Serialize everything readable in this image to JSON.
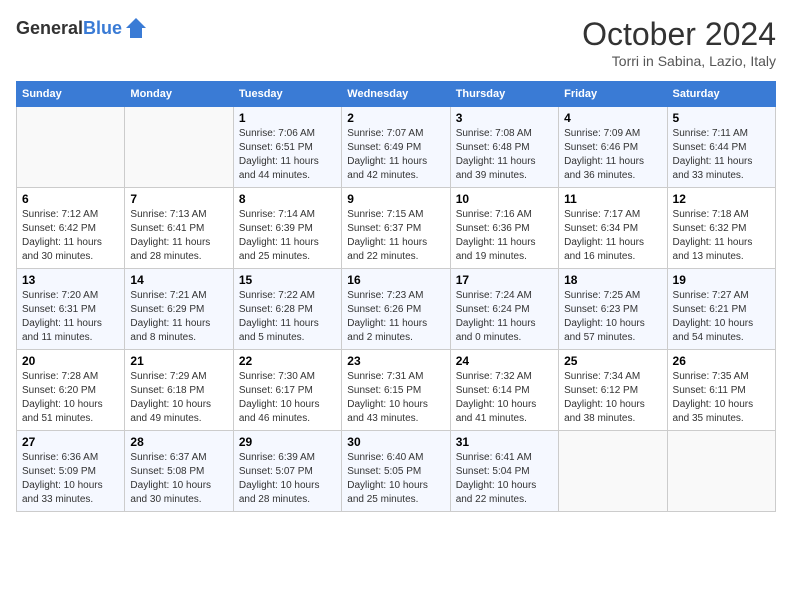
{
  "header": {
    "logo_general": "General",
    "logo_blue": "Blue",
    "title": "October 2024",
    "location": "Torri in Sabina, Lazio, Italy"
  },
  "days_of_week": [
    "Sunday",
    "Monday",
    "Tuesday",
    "Wednesday",
    "Thursday",
    "Friday",
    "Saturday"
  ],
  "weeks": [
    [
      {
        "day": "",
        "sunrise": "",
        "sunset": "",
        "daylight": ""
      },
      {
        "day": "",
        "sunrise": "",
        "sunset": "",
        "daylight": ""
      },
      {
        "day": "1",
        "sunrise": "Sunrise: 7:06 AM",
        "sunset": "Sunset: 6:51 PM",
        "daylight": "Daylight: 11 hours and 44 minutes."
      },
      {
        "day": "2",
        "sunrise": "Sunrise: 7:07 AM",
        "sunset": "Sunset: 6:49 PM",
        "daylight": "Daylight: 11 hours and 42 minutes."
      },
      {
        "day": "3",
        "sunrise": "Sunrise: 7:08 AM",
        "sunset": "Sunset: 6:48 PM",
        "daylight": "Daylight: 11 hours and 39 minutes."
      },
      {
        "day": "4",
        "sunrise": "Sunrise: 7:09 AM",
        "sunset": "Sunset: 6:46 PM",
        "daylight": "Daylight: 11 hours and 36 minutes."
      },
      {
        "day": "5",
        "sunrise": "Sunrise: 7:11 AM",
        "sunset": "Sunset: 6:44 PM",
        "daylight": "Daylight: 11 hours and 33 minutes."
      }
    ],
    [
      {
        "day": "6",
        "sunrise": "Sunrise: 7:12 AM",
        "sunset": "Sunset: 6:42 PM",
        "daylight": "Daylight: 11 hours and 30 minutes."
      },
      {
        "day": "7",
        "sunrise": "Sunrise: 7:13 AM",
        "sunset": "Sunset: 6:41 PM",
        "daylight": "Daylight: 11 hours and 28 minutes."
      },
      {
        "day": "8",
        "sunrise": "Sunrise: 7:14 AM",
        "sunset": "Sunset: 6:39 PM",
        "daylight": "Daylight: 11 hours and 25 minutes."
      },
      {
        "day": "9",
        "sunrise": "Sunrise: 7:15 AM",
        "sunset": "Sunset: 6:37 PM",
        "daylight": "Daylight: 11 hours and 22 minutes."
      },
      {
        "day": "10",
        "sunrise": "Sunrise: 7:16 AM",
        "sunset": "Sunset: 6:36 PM",
        "daylight": "Daylight: 11 hours and 19 minutes."
      },
      {
        "day": "11",
        "sunrise": "Sunrise: 7:17 AM",
        "sunset": "Sunset: 6:34 PM",
        "daylight": "Daylight: 11 hours and 16 minutes."
      },
      {
        "day": "12",
        "sunrise": "Sunrise: 7:18 AM",
        "sunset": "Sunset: 6:32 PM",
        "daylight": "Daylight: 11 hours and 13 minutes."
      }
    ],
    [
      {
        "day": "13",
        "sunrise": "Sunrise: 7:20 AM",
        "sunset": "Sunset: 6:31 PM",
        "daylight": "Daylight: 11 hours and 11 minutes."
      },
      {
        "day": "14",
        "sunrise": "Sunrise: 7:21 AM",
        "sunset": "Sunset: 6:29 PM",
        "daylight": "Daylight: 11 hours and 8 minutes."
      },
      {
        "day": "15",
        "sunrise": "Sunrise: 7:22 AM",
        "sunset": "Sunset: 6:28 PM",
        "daylight": "Daylight: 11 hours and 5 minutes."
      },
      {
        "day": "16",
        "sunrise": "Sunrise: 7:23 AM",
        "sunset": "Sunset: 6:26 PM",
        "daylight": "Daylight: 11 hours and 2 minutes."
      },
      {
        "day": "17",
        "sunrise": "Sunrise: 7:24 AM",
        "sunset": "Sunset: 6:24 PM",
        "daylight": "Daylight: 11 hours and 0 minutes."
      },
      {
        "day": "18",
        "sunrise": "Sunrise: 7:25 AM",
        "sunset": "Sunset: 6:23 PM",
        "daylight": "Daylight: 10 hours and 57 minutes."
      },
      {
        "day": "19",
        "sunrise": "Sunrise: 7:27 AM",
        "sunset": "Sunset: 6:21 PM",
        "daylight": "Daylight: 10 hours and 54 minutes."
      }
    ],
    [
      {
        "day": "20",
        "sunrise": "Sunrise: 7:28 AM",
        "sunset": "Sunset: 6:20 PM",
        "daylight": "Daylight: 10 hours and 51 minutes."
      },
      {
        "day": "21",
        "sunrise": "Sunrise: 7:29 AM",
        "sunset": "Sunset: 6:18 PM",
        "daylight": "Daylight: 10 hours and 49 minutes."
      },
      {
        "day": "22",
        "sunrise": "Sunrise: 7:30 AM",
        "sunset": "Sunset: 6:17 PM",
        "daylight": "Daylight: 10 hours and 46 minutes."
      },
      {
        "day": "23",
        "sunrise": "Sunrise: 7:31 AM",
        "sunset": "Sunset: 6:15 PM",
        "daylight": "Daylight: 10 hours and 43 minutes."
      },
      {
        "day": "24",
        "sunrise": "Sunrise: 7:32 AM",
        "sunset": "Sunset: 6:14 PM",
        "daylight": "Daylight: 10 hours and 41 minutes."
      },
      {
        "day": "25",
        "sunrise": "Sunrise: 7:34 AM",
        "sunset": "Sunset: 6:12 PM",
        "daylight": "Daylight: 10 hours and 38 minutes."
      },
      {
        "day": "26",
        "sunrise": "Sunrise: 7:35 AM",
        "sunset": "Sunset: 6:11 PM",
        "daylight": "Daylight: 10 hours and 35 minutes."
      }
    ],
    [
      {
        "day": "27",
        "sunrise": "Sunrise: 6:36 AM",
        "sunset": "Sunset: 5:09 PM",
        "daylight": "Daylight: 10 hours and 33 minutes."
      },
      {
        "day": "28",
        "sunrise": "Sunrise: 6:37 AM",
        "sunset": "Sunset: 5:08 PM",
        "daylight": "Daylight: 10 hours and 30 minutes."
      },
      {
        "day": "29",
        "sunrise": "Sunrise: 6:39 AM",
        "sunset": "Sunset: 5:07 PM",
        "daylight": "Daylight: 10 hours and 28 minutes."
      },
      {
        "day": "30",
        "sunrise": "Sunrise: 6:40 AM",
        "sunset": "Sunset: 5:05 PM",
        "daylight": "Daylight: 10 hours and 25 minutes."
      },
      {
        "day": "31",
        "sunrise": "Sunrise: 6:41 AM",
        "sunset": "Sunset: 5:04 PM",
        "daylight": "Daylight: 10 hours and 22 minutes."
      },
      {
        "day": "",
        "sunrise": "",
        "sunset": "",
        "daylight": ""
      },
      {
        "day": "",
        "sunrise": "",
        "sunset": "",
        "daylight": ""
      }
    ]
  ]
}
